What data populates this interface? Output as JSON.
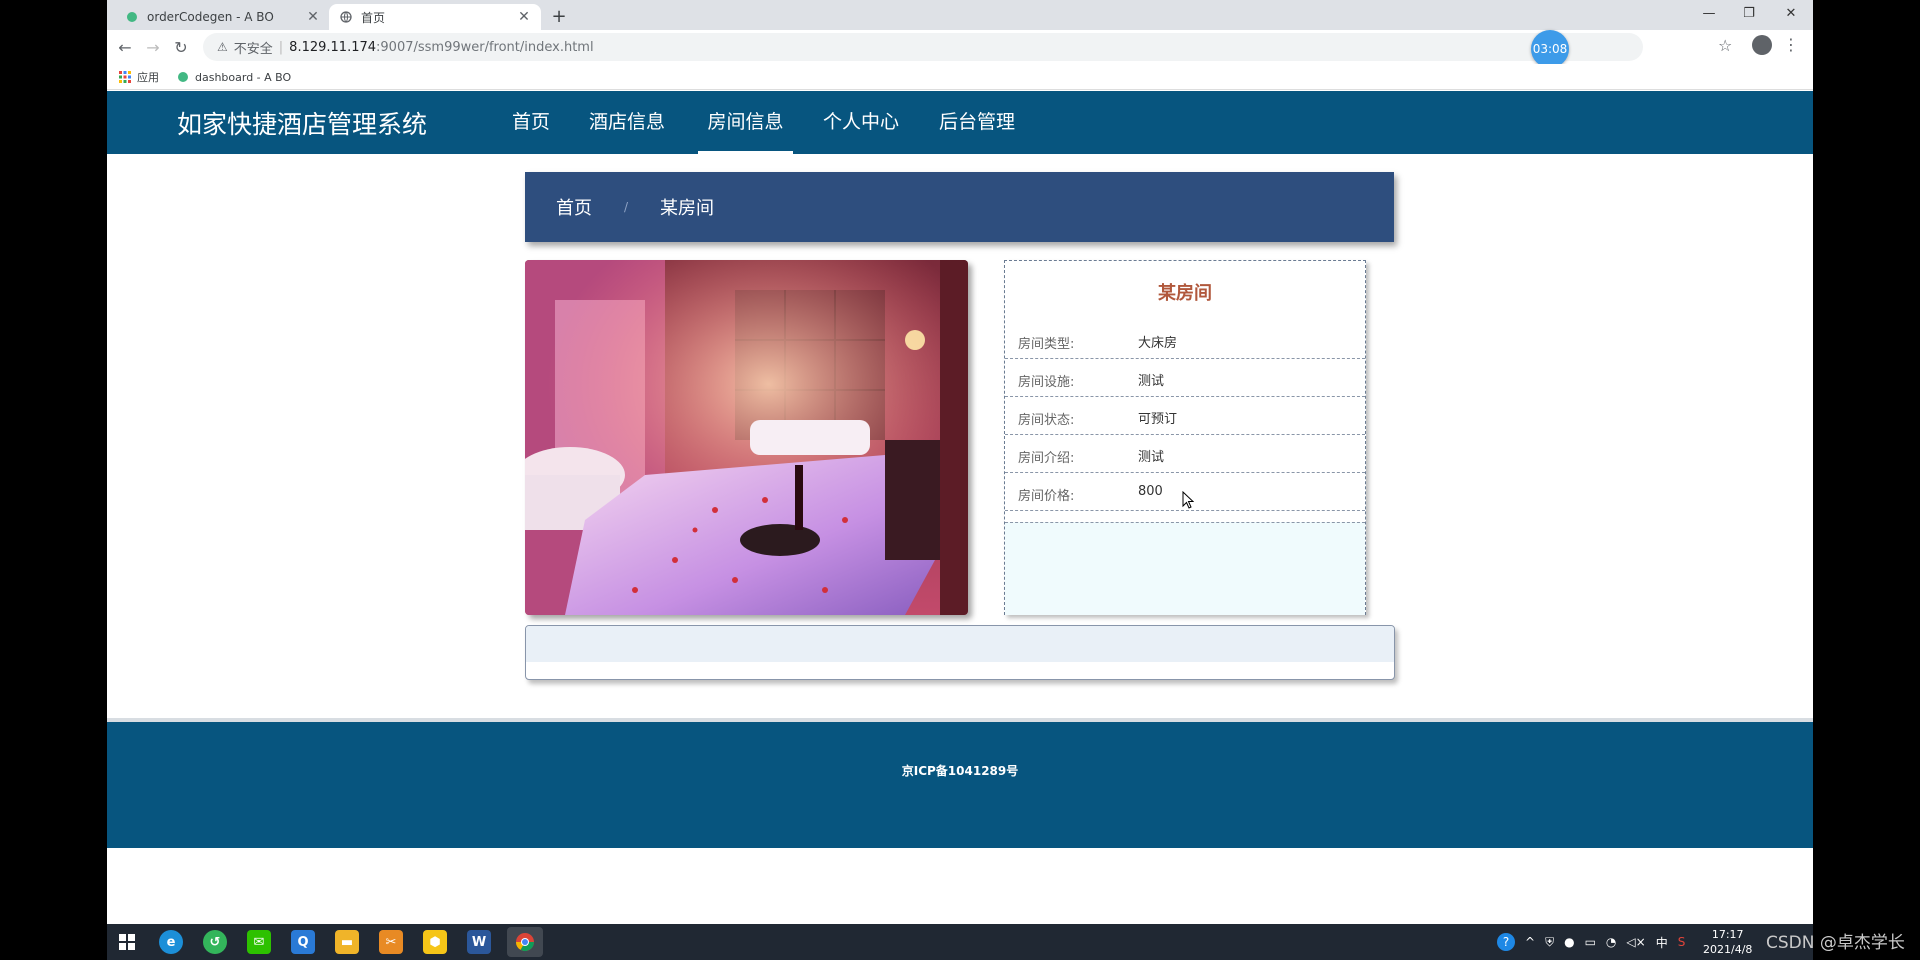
{
  "browser": {
    "tabs": [
      {
        "title": "orderCodegen - A BO",
        "active": false
      },
      {
        "title": "首页",
        "active": true
      }
    ],
    "security_label": "不安全",
    "url_host": "8.129.11.174",
    "url_path": ":9007/ssm99wer/front/index.html",
    "timer": "03:08",
    "bookmarks": [
      {
        "label": "应用",
        "icon": "apps-grid-icon"
      },
      {
        "label": "dashboard - A BO",
        "icon": "site-favicon-icon"
      }
    ]
  },
  "site": {
    "title": "如家快捷酒店管理系统",
    "nav": [
      {
        "label": "首页",
        "active": false
      },
      {
        "label": "酒店信息",
        "active": false
      },
      {
        "label": "房间信息",
        "active": true
      },
      {
        "label": "个人中心",
        "active": false
      },
      {
        "label": "后台管理",
        "active": false
      }
    ]
  },
  "breadcrumb": {
    "home": "首页",
    "separator": "/",
    "current": "某房间"
  },
  "room": {
    "name": "某房间",
    "fields": [
      {
        "label": "房间类型:",
        "value": "大床房"
      },
      {
        "label": "房间设施:",
        "value": "测试"
      },
      {
        "label": "房间状态:",
        "value": "可预订"
      },
      {
        "label": "房间介绍:",
        "value": "测试"
      },
      {
        "label": "房间价格:",
        "value": "800"
      }
    ]
  },
  "footer": {
    "icp": "京ICP备1041289号"
  },
  "taskbar": {
    "clock_time": "17:17",
    "clock_date": "2021/4/8",
    "ime": "中"
  },
  "watermark": "CSDN @卓杰学长",
  "colors": {
    "header": "#07557f",
    "breadcrumb": "#2e4e7e",
    "room_name": "#b1583c",
    "timer": "#3d9be9"
  }
}
